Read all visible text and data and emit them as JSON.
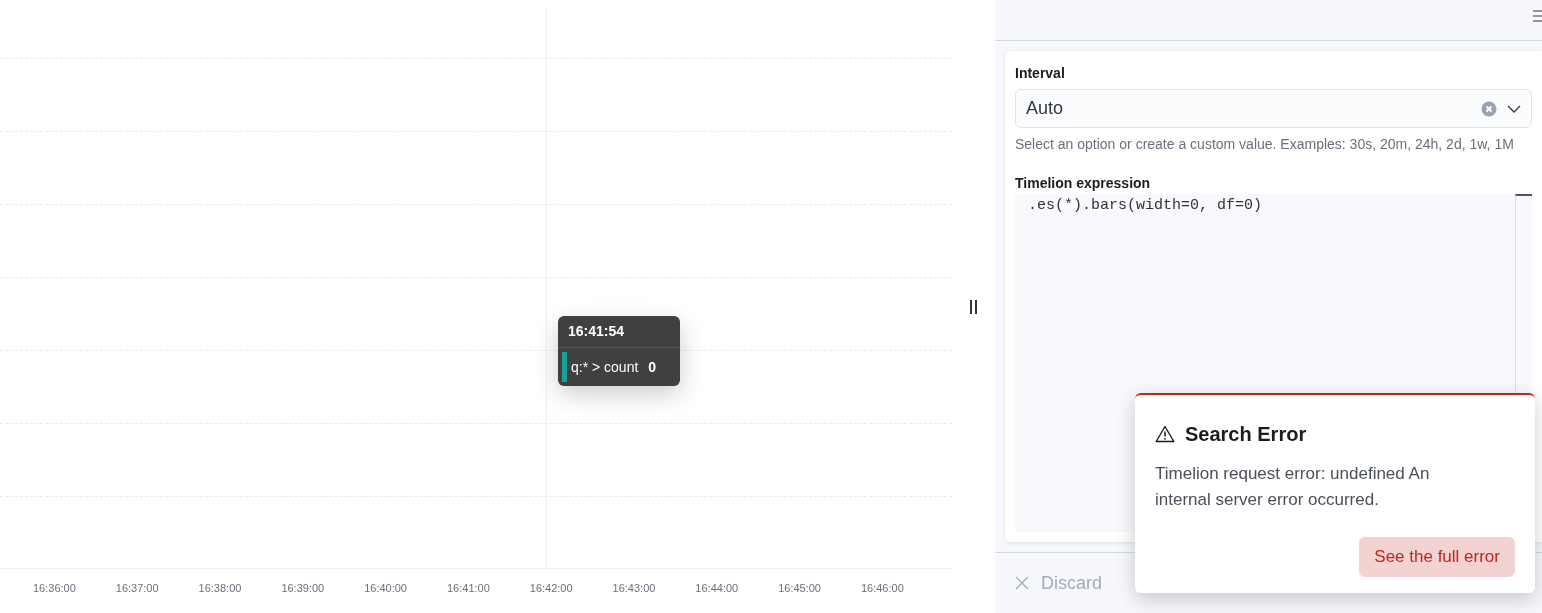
{
  "chart": {
    "x_labels": [
      "16:36:00",
      "16:37:00",
      "16:38:00",
      "16:39:00",
      "16:40:00",
      "16:41:00",
      "16:42:00",
      "16:43:00",
      "16:44:00",
      "16:45:00",
      "16:46:00"
    ],
    "tooltip": {
      "title": "16:41:54",
      "series": "q:* > count",
      "value": "0",
      "color": "#16a39a"
    }
  },
  "editor": {
    "interval": {
      "label": "Interval",
      "value": "Auto",
      "help": "Select an option or create a custom value. Examples: 30s, 20m, 24h, 2d, 1w, 1M"
    },
    "expression": {
      "label": "Timelion expression",
      "code": ".es(*).bars(width=0, df=0)"
    }
  },
  "footer": {
    "discard": "Discard"
  },
  "toast": {
    "title": "Search Error",
    "message": "Timelion request error: undefined An internal server error occurred.",
    "button": "See the full error"
  }
}
